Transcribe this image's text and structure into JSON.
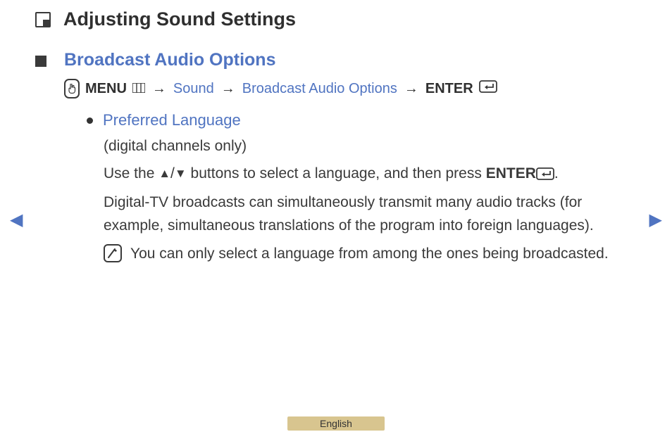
{
  "page": {
    "title": "Adjusting Sound Settings"
  },
  "section": {
    "title": "Broadcast Audio Options"
  },
  "breadcrumb": {
    "menu_label": "MENU",
    "arrow": "→",
    "sound": "Sound",
    "broadcast_audio_options": "Broadcast Audio Options",
    "enter_label": "ENTER"
  },
  "preferred_language": {
    "title": "Preferred Language",
    "subtitle": "(digital channels only)",
    "instruction_prefix": "Use the ",
    "up_symbol": "▲",
    "slash": "/",
    "down_symbol": "▼",
    "instruction_mid": " buttons to select a language, and then press ",
    "enter_label": "ENTER",
    "instruction_suffix": ".",
    "description": "Digital-TV broadcasts can simultaneously transmit many audio tracks (for example, simultaneous translations of the program into foreign languages).",
    "note": "You can only select a language from among the ones being broadcasted."
  },
  "footer": {
    "language": "English"
  }
}
